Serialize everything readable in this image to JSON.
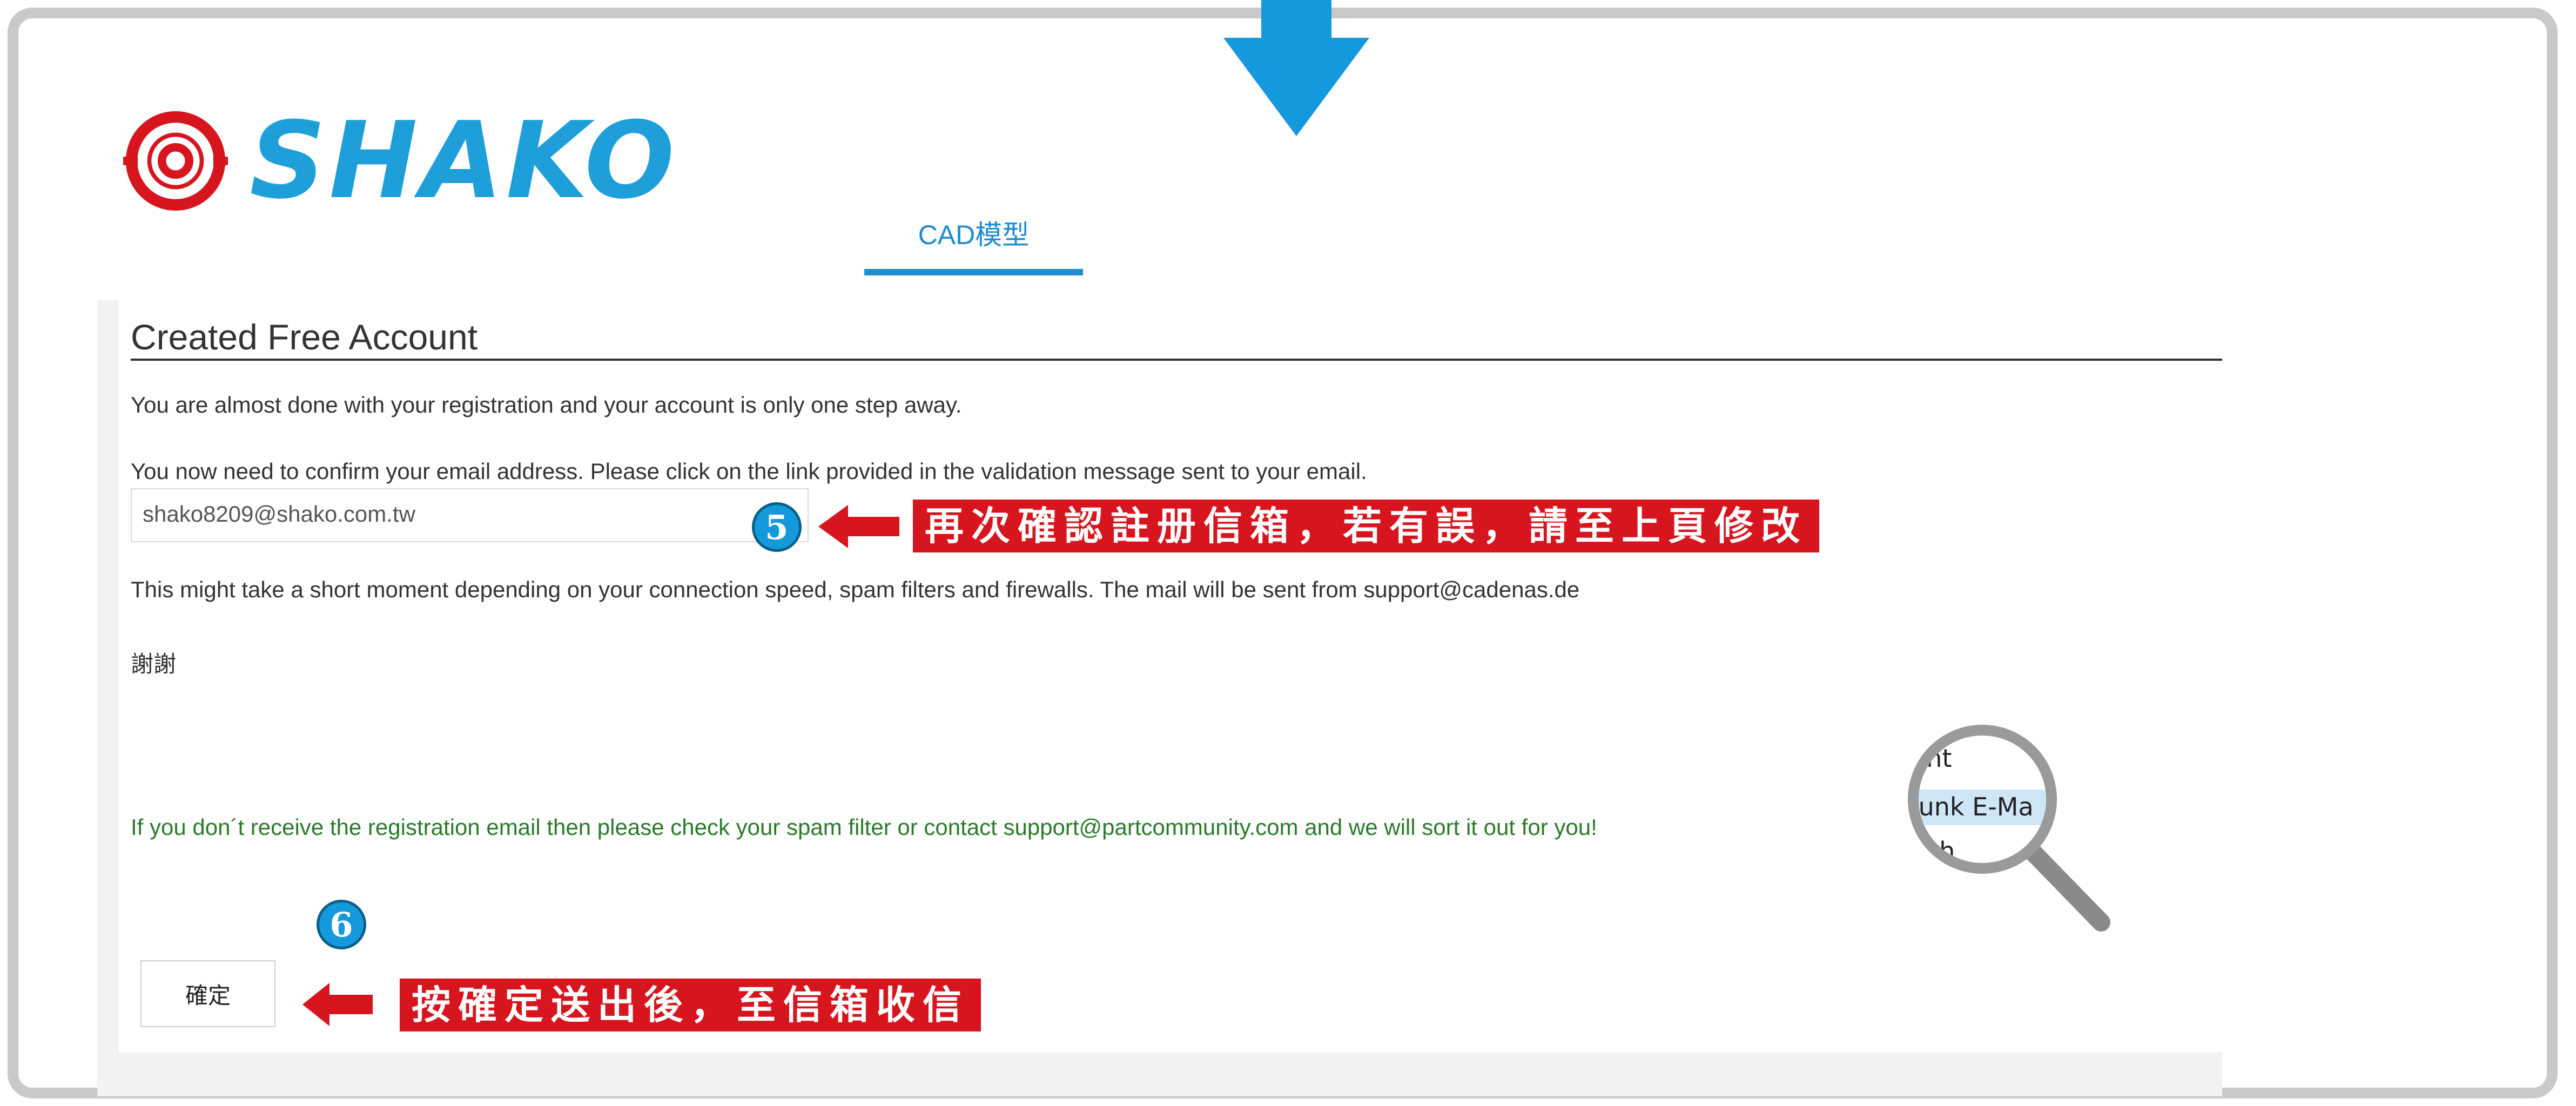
{
  "brand": {
    "name": "SHAKO",
    "primary_color": "#1e9fd9",
    "logo_red": "#d7151e"
  },
  "nav": {
    "tab_label": "CAD模型"
  },
  "page": {
    "title": "Created Free Account",
    "line1": "You are almost done with your registration and your account is only one step away.",
    "line2": "You now need to confirm your email address. Please click on the link provided in the validation message sent to your email.",
    "email_value": "shako8209@shako.com.tw",
    "line3": "This might take a short moment depending on your connection speed, spam filters and firewalls. The mail will be sent from support@cadenas.de",
    "thanks": "謝謝",
    "spam_note": "If you don´t receive the registration email then please check your spam filter or contact support@partcommunity.com and we will sort it out for you!",
    "confirm_button": "確定"
  },
  "annotations": {
    "step5": {
      "badge": "5",
      "text": "再次確認註册信箱，若有誤，請至上頁修改"
    },
    "step6": {
      "badge": "6",
      "text": "按確定送出後，至信箱收信"
    },
    "magnifier_lines": [
      "ent",
      "Junk E-Ma",
      "ash"
    ]
  }
}
